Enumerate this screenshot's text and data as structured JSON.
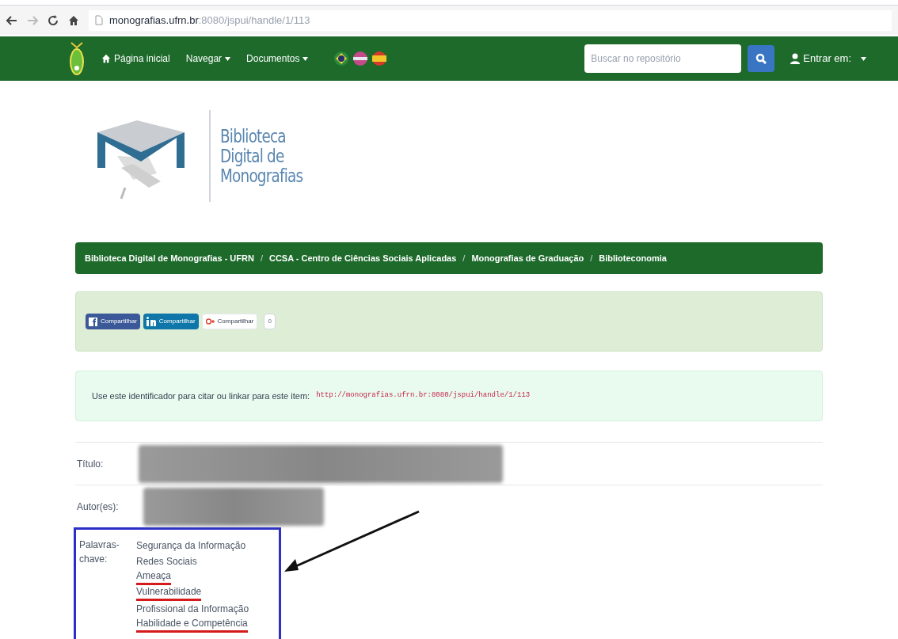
{
  "browser": {
    "url_host": "monografias.ufrn.br",
    "url_path": ":8080/jspui/handle/1/113"
  },
  "navbar": {
    "items": [
      {
        "label": "Página inicial",
        "kind": "home"
      },
      {
        "label": "Navegar",
        "kind": "dropdown"
      },
      {
        "label": "Documentos",
        "kind": "dropdown"
      }
    ],
    "search": {
      "placeholder": "Buscar no repositório"
    },
    "login": "Entrar em:"
  },
  "logo": {
    "lines": [
      "Biblioteca",
      "Digital de",
      "Monografias"
    ]
  },
  "breadcrumb_separator": "/",
  "breadcrumb": [
    "Biblioteca Digital de Monografias - UFRN",
    "CCSA - Centro de Ciências Sociais Aplicadas",
    "Monografias de Graduação",
    "Biblioteconomia"
  ],
  "share": [
    {
      "kind": "facebook",
      "label": "Compartilhar"
    },
    {
      "kind": "linkedin",
      "label": "Compartilhar"
    },
    {
      "kind": "google",
      "label": "Compartilhar"
    },
    {
      "kind": "count",
      "label": "0"
    }
  ],
  "identifier": {
    "text": "Use este identificador para citar ou linkar para este item:",
    "url": "http://monografias.ufrn.br:8080/jspui/handle/1/113"
  },
  "fields": [
    {
      "label": "Título:"
    },
    {
      "label": "Autor(es):"
    }
  ],
  "keywords": {
    "label": "Palavras-chave:",
    "items": [
      {
        "text": "Segurança da Informação",
        "underlined": false
      },
      {
        "text": "Redes Sociais",
        "underlined": false
      },
      {
        "text": "Ameaça",
        "underlined": true
      },
      {
        "text": "Vulnerabilidade",
        "underlined": true
      },
      {
        "text": "Profissional da Informação",
        "underlined": false
      },
      {
        "text": "Habilidade e Competência",
        "underlined": true
      }
    ]
  }
}
